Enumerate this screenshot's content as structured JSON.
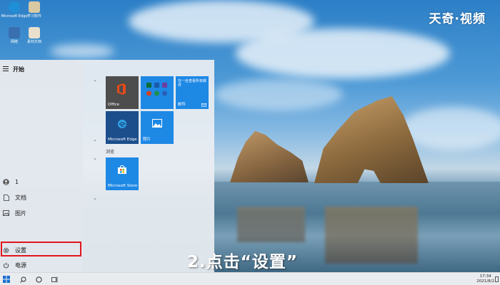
{
  "watermark": "天奇·视频",
  "desktop_icons": [
    {
      "label": "Microsoft Edge",
      "color": "#1f8fd8"
    },
    {
      "label": "学习软件",
      "color": "#d9c9a3"
    },
    {
      "label": "网络",
      "color": "#3a6fb0"
    },
    {
      "label": "素材文档",
      "color": "#e8e0cc"
    }
  ],
  "start_menu": {
    "title": "开始",
    "rail_items": [
      {
        "label": "1",
        "icon": "user-icon"
      },
      {
        "label": "文档",
        "icon": "document-icon"
      },
      {
        "label": "图片",
        "icon": "pictures-icon"
      },
      {
        "label": "设置",
        "icon": "gear-icon"
      },
      {
        "label": "电源",
        "icon": "power-icon"
      }
    ],
    "tiles": [
      {
        "label": "Office",
        "color": "#4d4d4d"
      },
      {
        "label": "",
        "color": "#1e88e5"
      },
      {
        "label": "邮件",
        "color": "#1e88e5",
        "detail": "在一处查看所有邮件"
      },
      {
        "label": "Microsoft Edge",
        "color": "#1c4e8c"
      },
      {
        "label": "照片",
        "color": "#1e88e5"
      },
      {
        "label": "Microsoft Store",
        "color": "#1e88e5"
      }
    ],
    "group_label": "浏览"
  },
  "caption": "2.点击“设置”",
  "taskbar": {
    "time": "17:34",
    "date": "2021/8/2"
  },
  "colors": {
    "highlight": "#e0161c",
    "tile_blue": "#1e88e5"
  }
}
